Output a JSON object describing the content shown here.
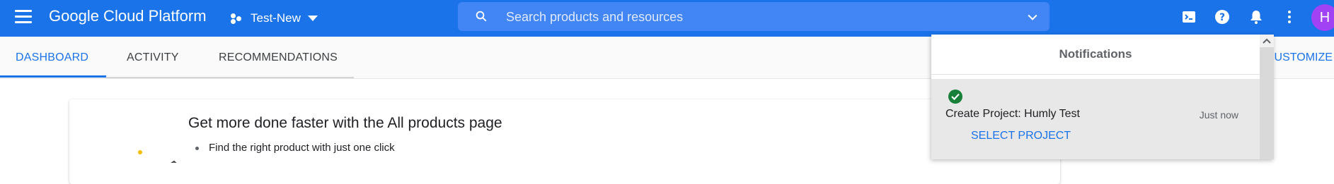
{
  "topbar": {
    "brand": "Google Cloud Platform",
    "project": "Test-New",
    "search_placeholder": "Search products and resources",
    "avatar_initial": "H",
    "colors": {
      "bar": "#1a73e8",
      "search": "#4285f4",
      "avatar": "#a142f4"
    },
    "icons": [
      "menu-icon",
      "project-dots-icon",
      "search-icon",
      "chevron-down-icon",
      "terminal-icon",
      "help-icon",
      "bell-icon",
      "more-vert-icon"
    ]
  },
  "tabs": {
    "items": [
      {
        "label": "DASHBOARD",
        "active": true
      },
      {
        "label": "ACTIVITY",
        "active": false
      },
      {
        "label": "RECOMMENDATIONS",
        "active": false
      }
    ],
    "customize": "CUSTOMIZE"
  },
  "card": {
    "title": "Get more done faster with the All products page",
    "bullets": [
      "Find the right product with just one click"
    ]
  },
  "notifications": {
    "header": "Notifications",
    "items": [
      {
        "status": "success",
        "title": "Create Project: Humly Test",
        "time": "Just now",
        "action": "SELECT PROJECT"
      }
    ]
  }
}
